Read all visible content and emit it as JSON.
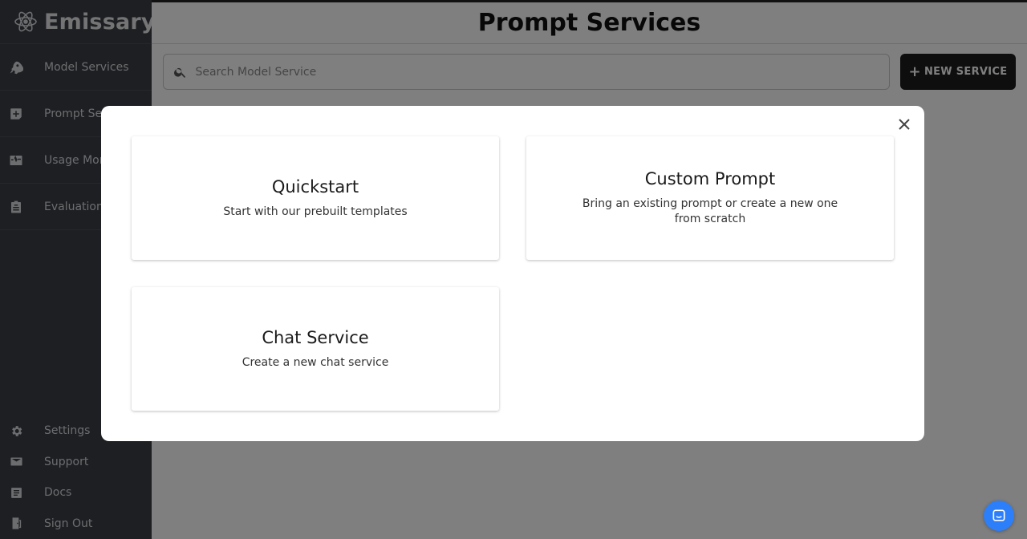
{
  "app": {
    "name": "Emissary"
  },
  "sidebar": {
    "items": [
      {
        "label": "Model Services",
        "icon": "rocket-icon"
      },
      {
        "label": "Prompt Services",
        "icon": "add-box-icon"
      },
      {
        "label": "Usage Monitoring",
        "icon": "monitor-heart-icon"
      },
      {
        "label": "Evaluations",
        "icon": "clipboard-icon"
      }
    ],
    "bottom": [
      {
        "label": "Settings",
        "icon": "gear-icon"
      },
      {
        "label": "Support",
        "icon": "mail-icon"
      },
      {
        "label": "Docs",
        "icon": "document-icon"
      },
      {
        "label": "Sign Out",
        "icon": "door-exit-icon"
      }
    ]
  },
  "main": {
    "title": "Prompt Services",
    "search": {
      "placeholder": "Search Model Service"
    },
    "new_button": {
      "label": "NEW SERVICE"
    }
  },
  "modal": {
    "cards": [
      {
        "title": "Quickstart",
        "description": "Start with our prebuilt templates"
      },
      {
        "title": "Custom Prompt",
        "description": "Bring an existing prompt or create a new one from scratch"
      },
      {
        "title": "Chat Service",
        "description": "Create a new chat service"
      }
    ]
  },
  "colors": {
    "sidebar_bg": "#3a3e45",
    "button_bg": "#1c1d1f",
    "chat_launcher": "#2d7ff9",
    "overlay": "rgba(0,0,0,0.5)"
  }
}
